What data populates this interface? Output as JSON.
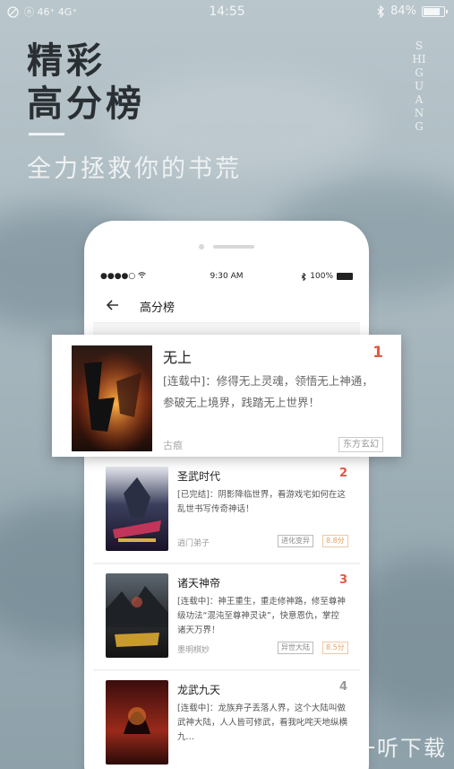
{
  "status_bar": {
    "time": "14:55",
    "left_text": "ⓝ 46⁺ 4G⁺",
    "bluetooth_icon": "bluetooth-icon",
    "battery": "84%",
    "battery_level": 0.84
  },
  "hero": {
    "title_line1": "精彩",
    "title_line2": "高分榜",
    "subtitle": "全力拯救你的书荒",
    "vertical_text": "SHIGUANG"
  },
  "phone": {
    "inner_status": {
      "signal": "●●●●○",
      "time": "9:30 AM",
      "battery": "100%"
    },
    "nav_title": "高分榜",
    "back_icon": "arrow-left-icon"
  },
  "featured": {
    "title": "无上",
    "rank": "1",
    "desc": "[连载中]：修得无上灵魂，领悟无上神通，参破无上境界，践踏无上世界！",
    "author": "古痕",
    "tag": "东方玄幻"
  },
  "books": [
    {
      "title": "圣武时代",
      "rank": "2",
      "desc": "[已完结]：阴影降临世界，看游戏宅如何在这乱世书写传奇神话！",
      "author": "逍门弟子",
      "tag": "进化变异",
      "score": "8.8分"
    },
    {
      "title": "诸天神帝",
      "rank": "3",
      "desc": "[连载中]：神王重生，重走修神路，修至尊神级功法“混沌至尊神灵诀”，快意恩仇，掌控诸天万界！",
      "author": "墨明棋妙",
      "tag": "异世大陆",
      "score": "8.5分"
    },
    {
      "title": "龙武九天",
      "rank": "4",
      "desc": "[连载中]：龙族弃子丢落人界，这个大陆叫做武神大陆，人人皆可修武，看我叱咤天地纵横九…",
      "author": "",
      "tag": "",
      "score": ""
    }
  ],
  "watermark": {
    "icon": "听",
    "text": "一听下载"
  }
}
